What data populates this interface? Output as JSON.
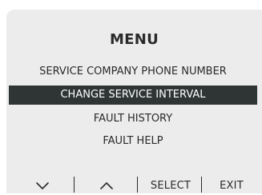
{
  "menu": {
    "title": "MENU",
    "items": [
      {
        "label": "SERVICE COMPANY PHONE NUMBER",
        "selected": false
      },
      {
        "label": "CHANGE SERVICE INTERVAL",
        "selected": true
      },
      {
        "label": "FAULT HISTORY",
        "selected": false
      },
      {
        "label": "FAULT HELP",
        "selected": false
      }
    ]
  },
  "softkeys": {
    "down_icon": "chevron-down-icon",
    "up_icon": "chevron-up-icon",
    "select_label": "SELECT",
    "exit_label": "EXIT"
  },
  "colors": {
    "background": "#ececec",
    "highlight": "#2f3434",
    "text": "#2a2a2a",
    "highlight_text": "#ffffff"
  }
}
